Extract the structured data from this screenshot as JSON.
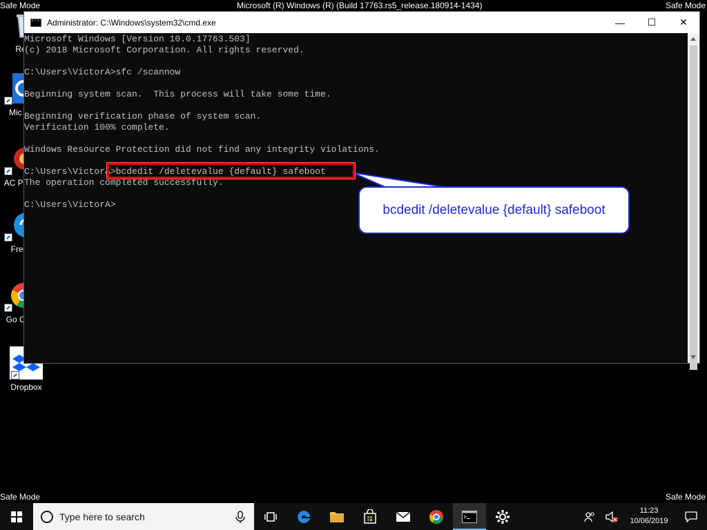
{
  "safe_mode_label": "Safe Mode",
  "build_label": "Microsoft (R) Windows (R) (Build 17763.rs5_release.180914-1434)",
  "desktop_icons": [
    {
      "label": "Recy",
      "icon": "recycle-bin-icon"
    },
    {
      "label": "Mic E",
      "icon": "edge-icon"
    },
    {
      "label": "AC Parti",
      "icon": "partition-tool-icon"
    },
    {
      "label": "Free",
      "icon": "free-app-icon"
    },
    {
      "label": "Go Chr",
      "icon": "chrome-icon"
    },
    {
      "label": "Dropbox",
      "icon": "dropbox-icon"
    }
  ],
  "window": {
    "title": "Administrator: C:\\Windows\\system32\\cmd.exe",
    "minimize": "—",
    "maximize": "☐",
    "close": "✕"
  },
  "console_lines": [
    "Microsoft Windows [Version 10.0.17763.503]",
    "(c) 2018 Microsoft Corporation. All rights reserved.",
    "",
    "C:\\Users\\VictorA>sfc /scannow",
    "",
    "Beginning system scan.  This process will take some time.",
    "",
    "Beginning verification phase of system scan.",
    "Verification 100% complete.",
    "",
    "Windows Resource Protection did not find any integrity violations.",
    "",
    "C:\\Users\\VictorA>bcdedit /deletevalue {default} safeboot",
    "The operation completed successfully.",
    "",
    "C:\\Users\\VictorA>"
  ],
  "callout_text": "bcdedit /deletevalue {default} safeboot",
  "taskbar": {
    "search_placeholder": "Type here to search",
    "clock_time": "11:23",
    "clock_date": "10/06/2019"
  }
}
